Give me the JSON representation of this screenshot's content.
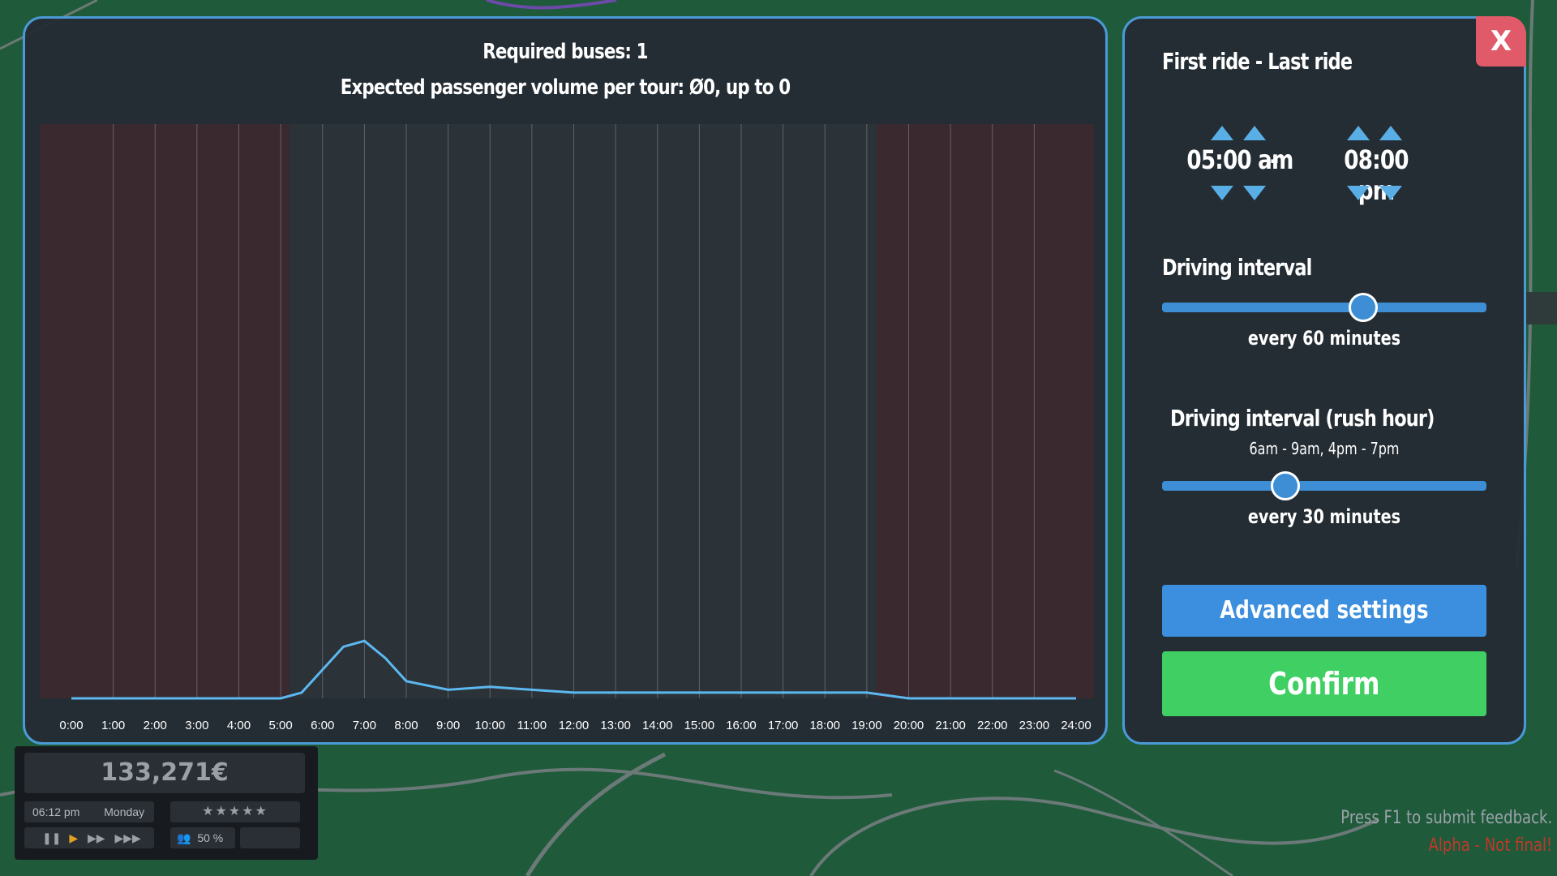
{
  "chart": {
    "required_buses": "Required buses: 1",
    "expected_volume": "Expected passenger volume per tour: Ø0, up to 0"
  },
  "chart_data": {
    "type": "area",
    "x_ticks": [
      "0:00",
      "1:00",
      "2:00",
      "3:00",
      "4:00",
      "5:00",
      "6:00",
      "7:00",
      "8:00",
      "9:00",
      "10:00",
      "11:00",
      "12:00",
      "13:00",
      "14:00",
      "15:00",
      "16:00",
      "17:00",
      "18:00",
      "19:00",
      "20:00",
      "21:00",
      "22:00",
      "23:00",
      "24:00"
    ],
    "xlim": [
      0,
      24
    ],
    "inactive_ranges": [
      [
        0,
        5
      ],
      [
        20,
        24
      ]
    ],
    "series": [
      {
        "x": [
          0,
          5,
          5.5,
          6,
          6.5,
          7,
          7.5,
          8,
          9,
          10,
          11,
          12,
          13,
          14,
          15,
          16,
          17,
          18,
          19,
          20,
          21,
          22,
          23,
          24
        ],
        "values": [
          0,
          0,
          0.1,
          0.5,
          0.9,
          1.0,
          0.7,
          0.3,
          0.15,
          0.2,
          0.15,
          0.1,
          0.1,
          0.1,
          0.1,
          0.1,
          0.1,
          0.1,
          0.1,
          0,
          0,
          0,
          0,
          0
        ]
      }
    ],
    "ylim": [
      0,
      10
    ],
    "colors": {
      "line": "#5cb8f0",
      "inactive": "#3a2a30",
      "active": "#2b3238",
      "grid": "#9aa3aa"
    }
  },
  "settings": {
    "first_last_title": "First ride - Last ride",
    "first_ride": "05:00 am",
    "separator": "-",
    "last_ride": "08:00 pm",
    "interval_title": "Driving interval",
    "interval_value": "every 60 minutes",
    "interval_level": 0.62,
    "rush_title": "Driving interval (rush hour)",
    "rush_hours": "6am - 9am,  4pm - 7pm",
    "rush_value": "every 30 minutes",
    "rush_level": 0.38,
    "advanced_label": "Advanced settings",
    "confirm_label": "Confirm",
    "close_label": "X"
  },
  "hud": {
    "money": "133,271€",
    "time": "06:12 pm",
    "day": "Monday",
    "stars": "★★★★★",
    "passengers": "50 %"
  },
  "footer": {
    "feedback": "Press F1 to submit feedback.",
    "alpha": "Alpha - Not final!"
  }
}
